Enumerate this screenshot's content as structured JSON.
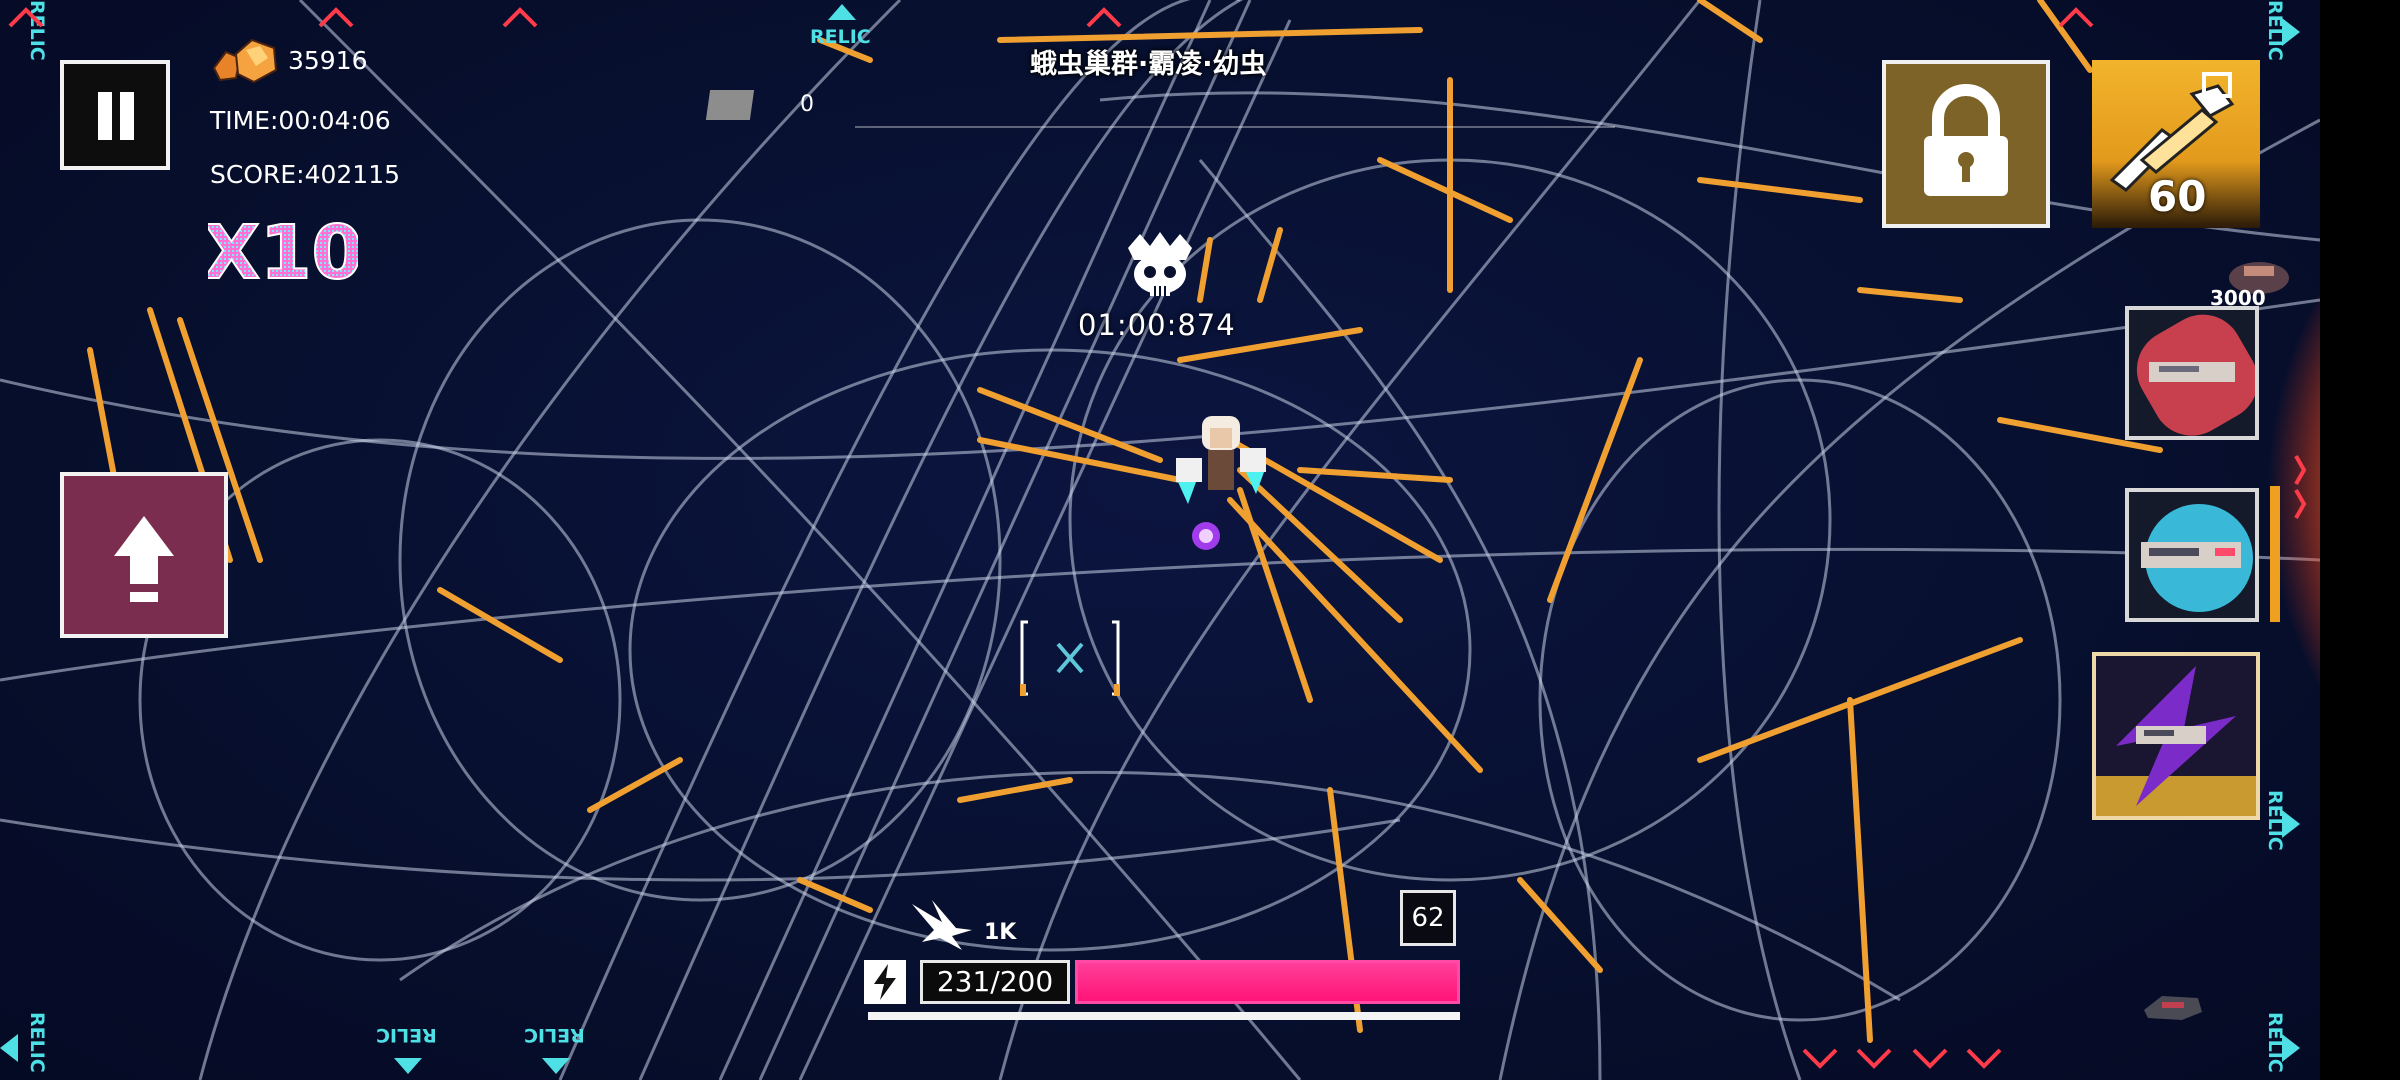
{
  "hud": {
    "gem_count": "35916",
    "time": "TIME:00:04:06",
    "score": "SCORE:402115",
    "combo": "X10"
  },
  "stage": {
    "title": "蛾虫巢群·霸凌·幼虫",
    "mini_count": "0",
    "boss_timer": "01:00:874"
  },
  "edge_markers": {
    "relic_label": "RELIC"
  },
  "right_panel": {
    "skill_count": "60"
  },
  "bottom": {
    "hp_text": "231/200",
    "hp_fraction": 1.0,
    "damage_label": "1K",
    "bits_count": "62"
  },
  "effects": {
    "floating_number": "3000"
  },
  "colors": {
    "background": "#07102f",
    "accent_cyan": "#4fe0e6",
    "hp_pink": "#ff2b8a",
    "combo_pink": "#ff66cc",
    "warning_red": "#e8334a"
  },
  "icons": {
    "pause": "pause-icon",
    "lock": "lock-icon",
    "upgrade": "upload-arrow-icon",
    "gem": "gem-icon",
    "energy": "lightning-icon",
    "boss": "skull-crown-icon"
  }
}
